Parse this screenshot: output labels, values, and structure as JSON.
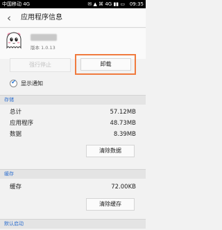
{
  "status_bar": {
    "carrier": "中国移动 4G",
    "icons": "✉ ▲ ⌘ 4G ▮▮ ▭",
    "time": "09:35"
  },
  "app_bar": {
    "title": "应用程序信息"
  },
  "app": {
    "icon": "cartoon-ghost-icon",
    "version": "版本 1.0.13"
  },
  "actions": {
    "force_stop_label": "强行停止",
    "uninstall_label": "卸载",
    "highlight_color": "#f07a3e"
  },
  "notifications": {
    "label": "显示通知",
    "checked": true
  },
  "storage": {
    "header": "存储",
    "rows": [
      {
        "label": "总计",
        "value": "57.12MB"
      },
      {
        "label": "应用程序",
        "value": "48.73MB"
      },
      {
        "label": "数据",
        "value": "8.39MB"
      }
    ],
    "clear_data_label": "清除数据"
  },
  "cache": {
    "header": "缓存",
    "label": "缓存",
    "value": "72.00KB",
    "clear_cache_label": "清除缓存"
  },
  "launch": {
    "header": "默认启动"
  }
}
